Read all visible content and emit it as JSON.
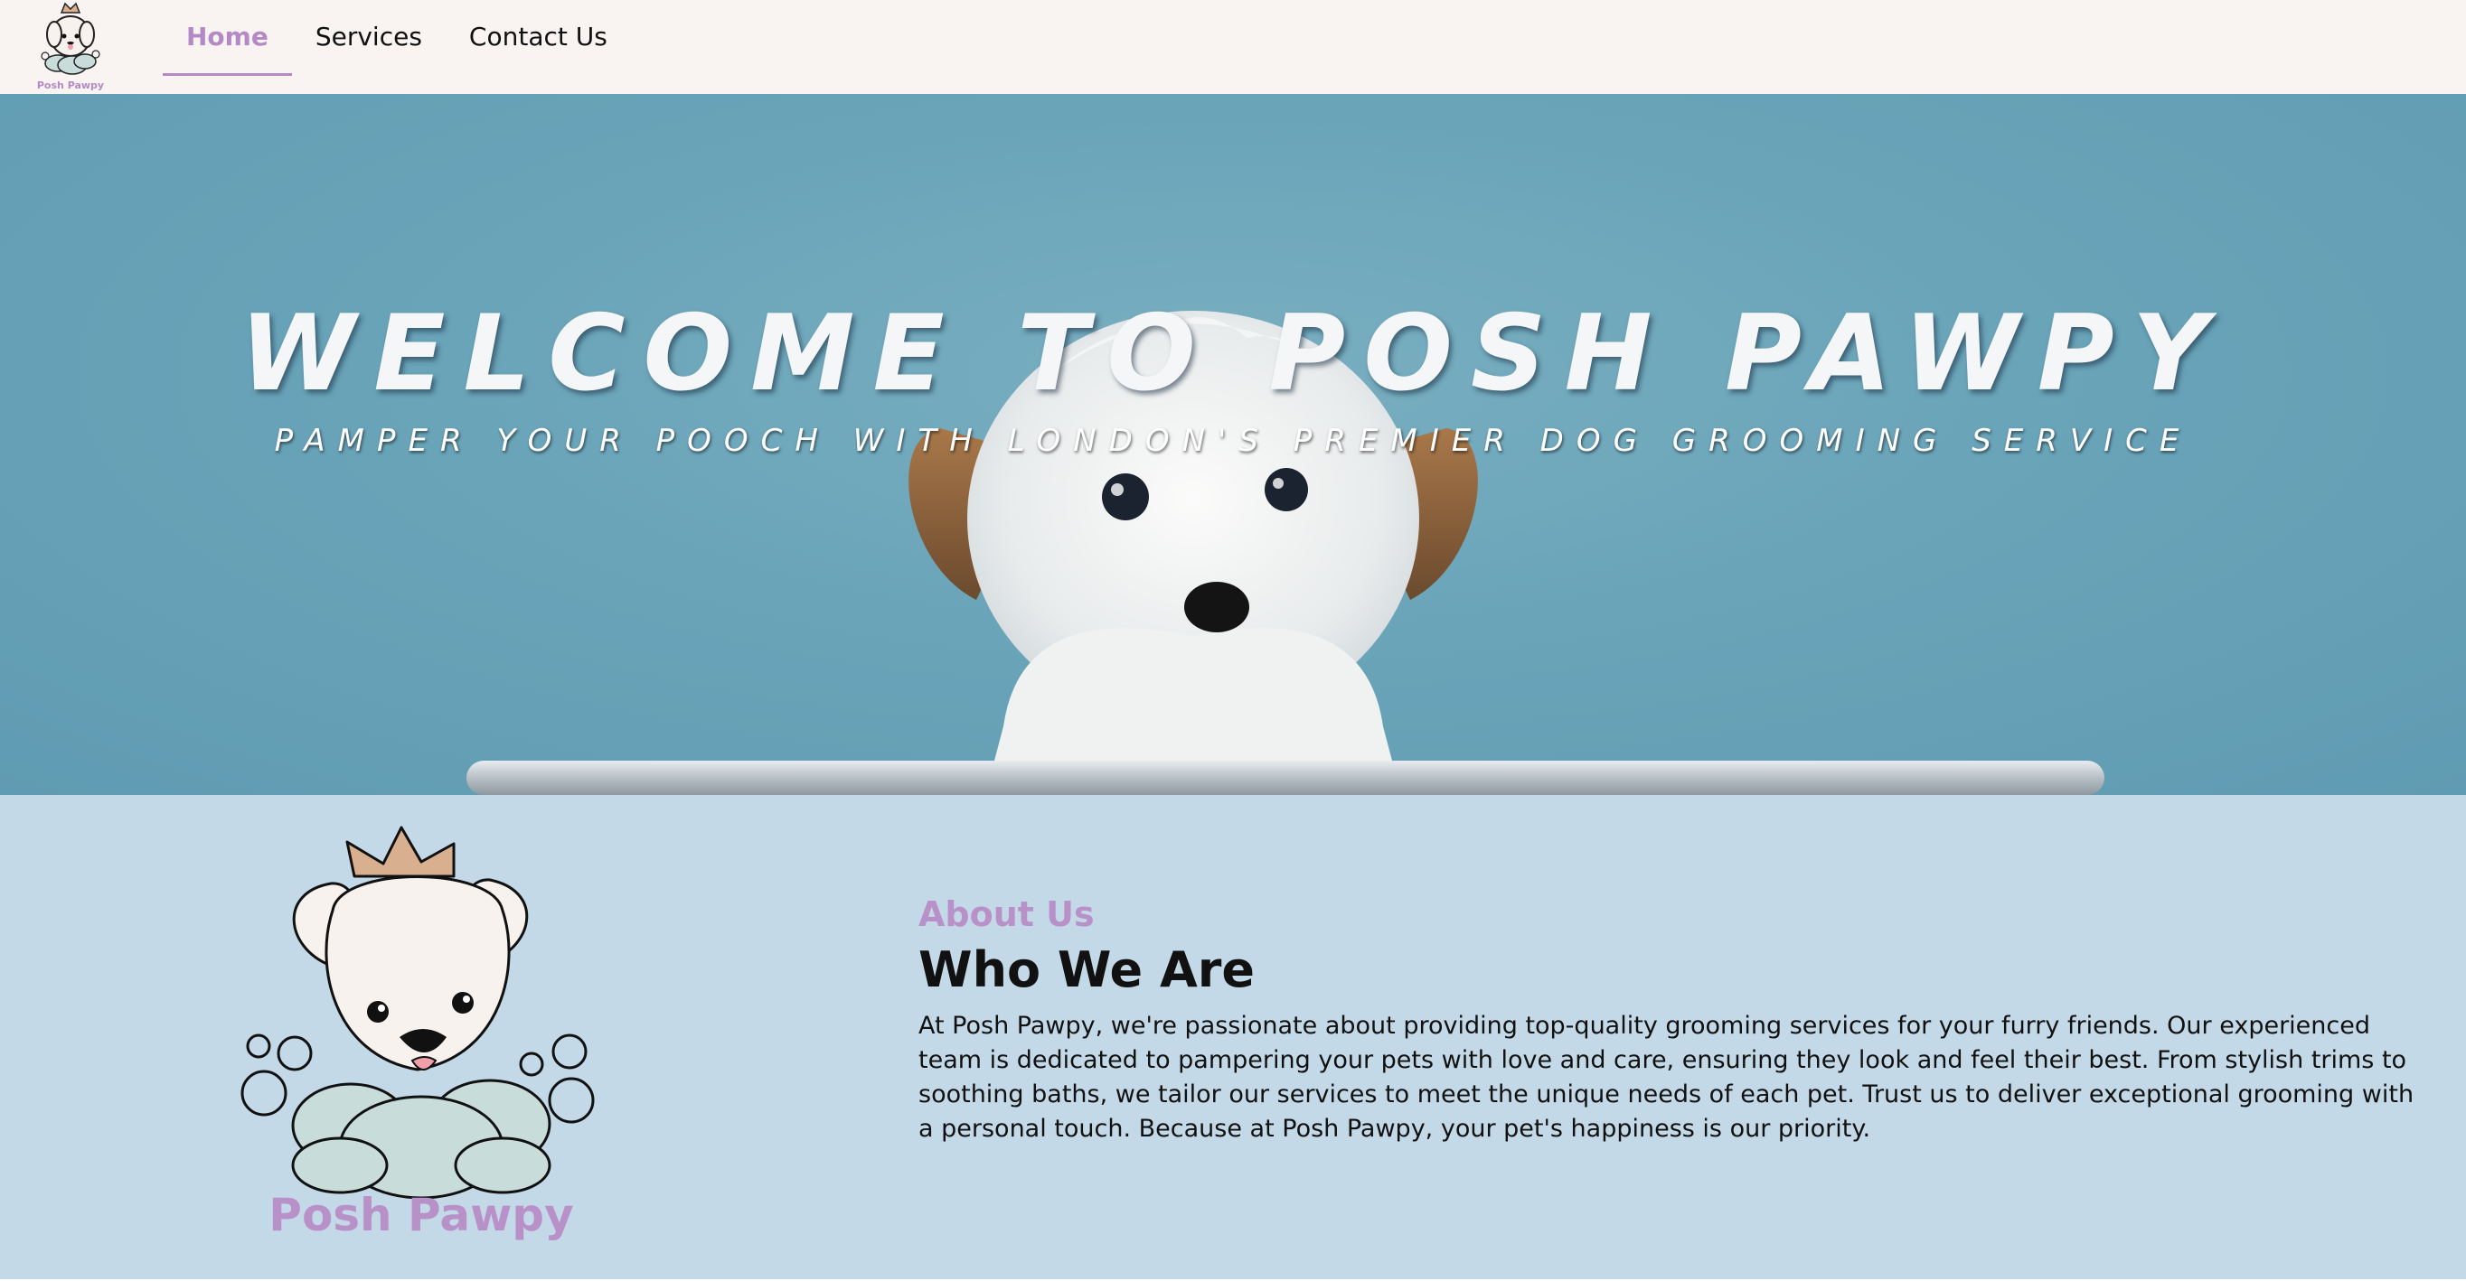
{
  "nav": {
    "logo_text": "Posh Pawpy",
    "links": [
      {
        "label": "Home",
        "active": true
      },
      {
        "label": "Services",
        "active": false
      },
      {
        "label": "Contact Us",
        "active": false
      }
    ]
  },
  "hero": {
    "title": "WELCOME TO POSH PAWPY",
    "subtitle": "PAMPER YOUR POOCH WITH LONDON'S PREMIER DOG GROOMING SERVICE"
  },
  "about": {
    "brand": "Posh Pawpy",
    "eyebrow": "About Us",
    "heading": "Who We Are",
    "body": "At Posh Pawpy, we're passionate about providing top-quality grooming services for your furry friends. Our experienced team is dedicated to pampering your pets with love and care, ensuring they look and feel their best. From stylish trims to soothing baths, we tailor our services to meet the unique needs of each pet. Trust us to deliver exceptional grooming with a personal touch. Because at Posh Pawpy, your pet's happiness is our priority."
  },
  "colors": {
    "accent": "#b48ac6",
    "nav_bg": "#f9f3f2",
    "hero_bg": "#6aa4b9",
    "about_bg": "#c4d9e7",
    "cloud": "#c8ddda",
    "crown": "#d8b090"
  },
  "icons": [
    "posh-pawpy-logo-icon",
    "dog-photo-image",
    "grooming-tub-image"
  ]
}
